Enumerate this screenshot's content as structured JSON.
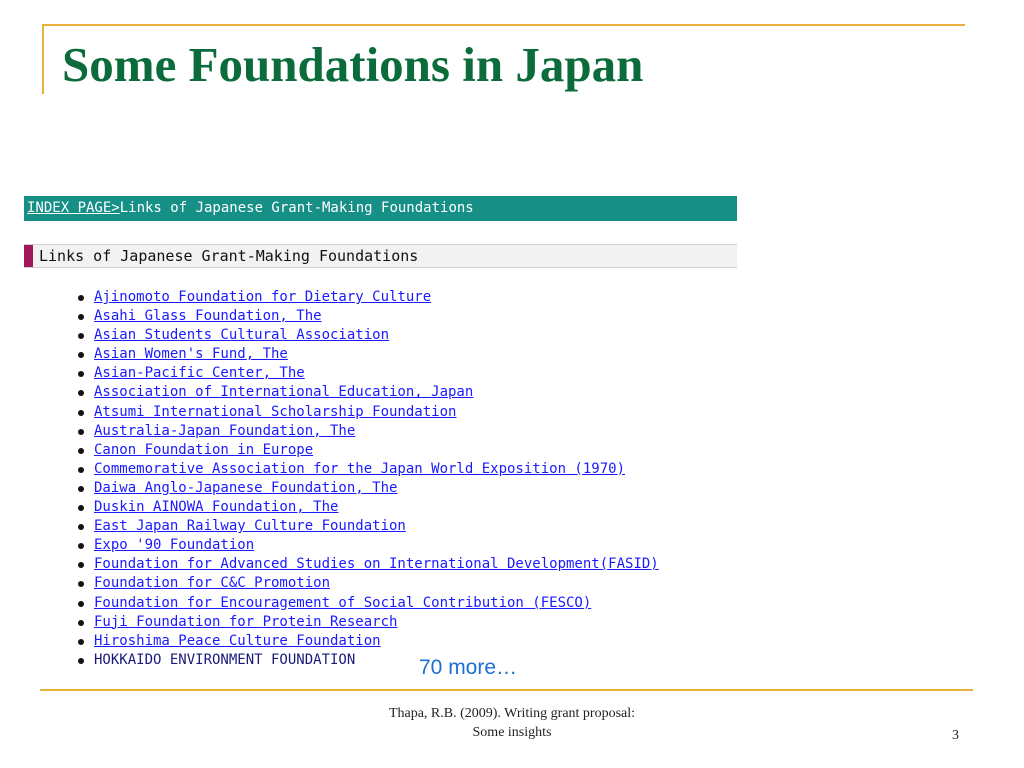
{
  "slide": {
    "title": "Some Foundations in Japan",
    "more_text": "70 more…",
    "citation_line1": "Thapa, R.B. (2009). Writing grant proposal:",
    "citation_line2": "Some insights",
    "page_number": "3"
  },
  "webpage": {
    "breadcrumb_link": "INDEX PAGE>",
    "breadcrumb_current": "Links of Japanese Grant-Making Foundations",
    "section_heading": "Links of Japanese Grant-Making Foundations",
    "links": [
      "Ajinomoto Foundation for Dietary Culture",
      "Asahi Glass Foundation, The",
      "Asian Students Cultural Association",
      "Asian Women's Fund, The",
      "Asian-Pacific Center, The",
      "Association of International Education, Japan",
      "Atsumi International Scholarship Foundation",
      "Australia-Japan Foundation, The",
      "Canon Foundation in Europe",
      "Commemorative Association for the Japan World Exposition (1970)",
      "Daiwa Anglo-Japanese Foundation, The",
      "Duskin AINOWA Foundation, The",
      "East Japan Railway Culture Foundation",
      "Expo '90 Foundation",
      "Foundation for Advanced Studies on International Development(FASID)",
      "Foundation for C&C Promotion",
      "Foundation for Encouragement of Social Contribution (FESCO)",
      "Fuji Foundation for Protein Research",
      "Hiroshima Peace Culture Foundation",
      "HOKKAIDO ENVIRONMENT FOUNDATION"
    ]
  },
  "colors": {
    "title": "#0b6b3a",
    "frame": "#e8b13a",
    "breadcrumb_bar": "#168f86",
    "heading_marker": "#a0185a",
    "link": "#1a1aff",
    "more_text": "#1b6fd0"
  }
}
